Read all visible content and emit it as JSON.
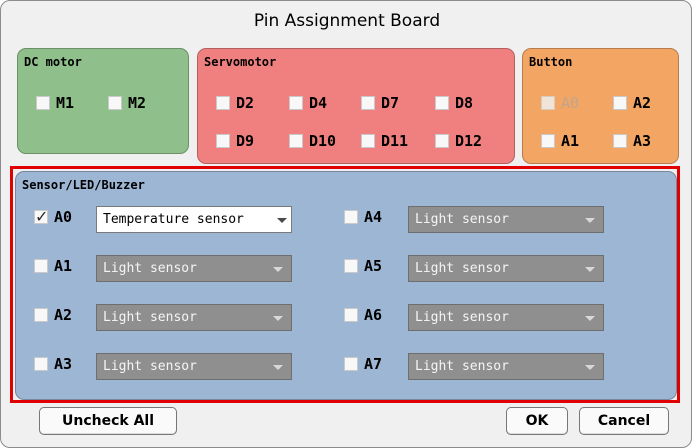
{
  "dialog": {
    "title": "Pin Assignment Board"
  },
  "dc_motor": {
    "title": "DC motor",
    "pins": [
      {
        "label": "M1",
        "checked": false
      },
      {
        "label": "M2",
        "checked": false
      }
    ]
  },
  "servomotor": {
    "title": "Servomotor",
    "pins": [
      {
        "label": "D2",
        "checked": false
      },
      {
        "label": "D4",
        "checked": false
      },
      {
        "label": "D7",
        "checked": false
      },
      {
        "label": "D8",
        "checked": false
      },
      {
        "label": "D9",
        "checked": false
      },
      {
        "label": "D10",
        "checked": false
      },
      {
        "label": "D11",
        "checked": false
      },
      {
        "label": "D12",
        "checked": false
      }
    ]
  },
  "button": {
    "title": "Button",
    "pins": [
      {
        "label": "A0",
        "checked": false,
        "disabled": true
      },
      {
        "label": "A2",
        "checked": false
      },
      {
        "label": "A1",
        "checked": false
      },
      {
        "label": "A3",
        "checked": false
      }
    ]
  },
  "sensor": {
    "title": "Sensor/LED/Buzzer",
    "pins": [
      {
        "label": "A0",
        "checked": true,
        "value": "Temperature sensor"
      },
      {
        "label": "A1",
        "checked": false,
        "value": "Light sensor"
      },
      {
        "label": "A2",
        "checked": false,
        "value": "Light sensor"
      },
      {
        "label": "A3",
        "checked": false,
        "value": "Light sensor"
      },
      {
        "label": "A4",
        "checked": false,
        "value": "Light sensor"
      },
      {
        "label": "A5",
        "checked": false,
        "value": "Light sensor"
      },
      {
        "label": "A6",
        "checked": false,
        "value": "Light sensor"
      },
      {
        "label": "A7",
        "checked": false,
        "value": "Light sensor"
      }
    ]
  },
  "footer": {
    "uncheck_all": "Uncheck All",
    "ok": "OK",
    "cancel": "Cancel"
  },
  "colors": {
    "dc_motor": "#8fbf8a",
    "servomotor": "#f08080",
    "button": "#f3a664",
    "sensor": "#9cb6d4",
    "highlight": "#e00000"
  }
}
